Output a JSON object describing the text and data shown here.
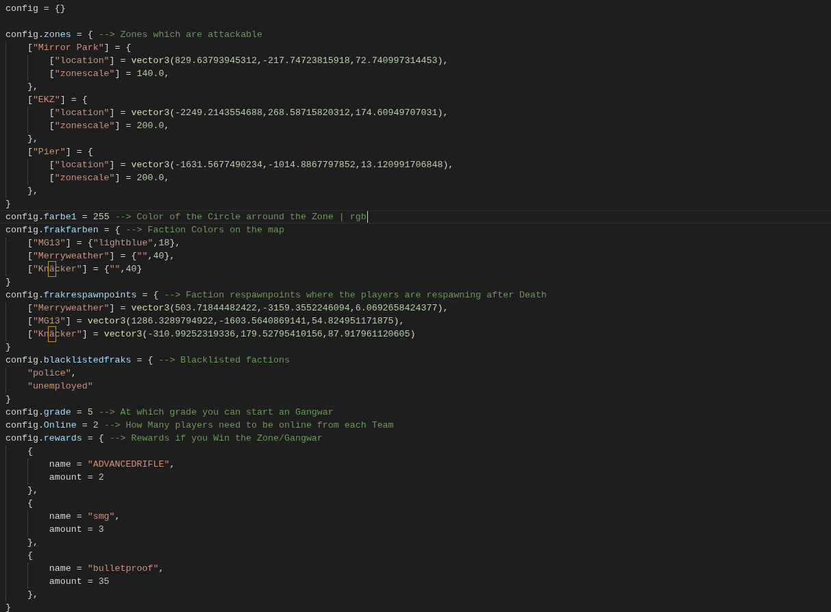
{
  "lines": [
    {
      "current": false,
      "tokens": [
        {
          "kind": "plain",
          "text": "config = {}"
        }
      ]
    },
    {
      "current": false
    },
    {
      "current": false,
      "tokens": [
        {
          "kind": "plain",
          "text": "config."
        },
        {
          "kind": "prop",
          "text": "zones"
        },
        {
          "kind": "plain",
          "text": " = { "
        },
        {
          "kind": "comment",
          "text": "--> Zones which are attackable"
        }
      ]
    },
    {
      "current": false,
      "tokens": [
        {
          "kind": "plain",
          "text": "    ["
        },
        {
          "kind": "str",
          "text": "\"Mirror Park\""
        },
        {
          "kind": "plain",
          "text": "] = {"
        }
      ]
    },
    {
      "current": false,
      "tokens": [
        {
          "kind": "plain",
          "text": "        ["
        },
        {
          "kind": "str",
          "text": "\"location\""
        },
        {
          "kind": "plain",
          "text": "] = "
        },
        {
          "kind": "func",
          "text": "vector3"
        },
        {
          "kind": "plain",
          "text": "("
        },
        {
          "kind": "num",
          "text": "829.63793945312"
        },
        {
          "kind": "plain",
          "text": ","
        },
        {
          "kind": "num",
          "text": "-217.74723815918"
        },
        {
          "kind": "plain",
          "text": ","
        },
        {
          "kind": "num",
          "text": "72.740997314453"
        },
        {
          "kind": "plain",
          "text": "),"
        }
      ]
    },
    {
      "current": false,
      "tokens": [
        {
          "kind": "plain",
          "text": "        ["
        },
        {
          "kind": "str",
          "text": "\"zonescale\""
        },
        {
          "kind": "plain",
          "text": "] = "
        },
        {
          "kind": "num",
          "text": "140.0"
        },
        {
          "kind": "plain",
          "text": ","
        }
      ]
    },
    {
      "current": false,
      "tokens": [
        {
          "kind": "plain",
          "text": "    },"
        }
      ]
    },
    {
      "current": false,
      "tokens": [
        {
          "kind": "plain",
          "text": "    ["
        },
        {
          "kind": "str",
          "text": "\"EKZ\""
        },
        {
          "kind": "plain",
          "text": "] = {"
        }
      ]
    },
    {
      "current": false,
      "tokens": [
        {
          "kind": "plain",
          "text": "        ["
        },
        {
          "kind": "str",
          "text": "\"location\""
        },
        {
          "kind": "plain",
          "text": "] = "
        },
        {
          "kind": "func",
          "text": "vector3"
        },
        {
          "kind": "plain",
          "text": "("
        },
        {
          "kind": "num",
          "text": "-2249.2143554688"
        },
        {
          "kind": "plain",
          "text": ","
        },
        {
          "kind": "num",
          "text": "268.58715820312"
        },
        {
          "kind": "plain",
          "text": ","
        },
        {
          "kind": "num",
          "text": "174.60949707031"
        },
        {
          "kind": "plain",
          "text": "),"
        }
      ]
    },
    {
      "current": false,
      "tokens": [
        {
          "kind": "plain",
          "text": "        ["
        },
        {
          "kind": "str",
          "text": "\"zonescale\""
        },
        {
          "kind": "plain",
          "text": "] = "
        },
        {
          "kind": "num",
          "text": "200.0"
        },
        {
          "kind": "plain",
          "text": ","
        }
      ]
    },
    {
      "current": false,
      "tokens": [
        {
          "kind": "plain",
          "text": "    },"
        }
      ]
    },
    {
      "current": false,
      "tokens": [
        {
          "kind": "plain",
          "text": "    ["
        },
        {
          "kind": "str",
          "text": "\"Pier\""
        },
        {
          "kind": "plain",
          "text": "] = {"
        }
      ]
    },
    {
      "current": false,
      "tokens": [
        {
          "kind": "plain",
          "text": "        ["
        },
        {
          "kind": "str",
          "text": "\"location\""
        },
        {
          "kind": "plain",
          "text": "] = "
        },
        {
          "kind": "func",
          "text": "vector3"
        },
        {
          "kind": "plain",
          "text": "("
        },
        {
          "kind": "num",
          "text": "-1631.5677490234"
        },
        {
          "kind": "plain",
          "text": ","
        },
        {
          "kind": "num",
          "text": "-1014.8867797852"
        },
        {
          "kind": "plain",
          "text": ","
        },
        {
          "kind": "num",
          "text": "13.120991706848"
        },
        {
          "kind": "plain",
          "text": "),"
        }
      ]
    },
    {
      "current": false,
      "tokens": [
        {
          "kind": "plain",
          "text": "        ["
        },
        {
          "kind": "str",
          "text": "\"zonescale\""
        },
        {
          "kind": "plain",
          "text": "] = "
        },
        {
          "kind": "num",
          "text": "200.0"
        },
        {
          "kind": "plain",
          "text": ","
        }
      ]
    },
    {
      "current": false,
      "tokens": [
        {
          "kind": "plain",
          "text": "    },"
        }
      ]
    },
    {
      "current": false,
      "tokens": [
        {
          "kind": "plain",
          "text": "}"
        }
      ]
    },
    {
      "current": true,
      "tokens": [
        {
          "kind": "plain",
          "text": "config."
        },
        {
          "kind": "prop",
          "text": "farbe1"
        },
        {
          "kind": "plain",
          "text": " = "
        },
        {
          "kind": "num",
          "text": "255"
        },
        {
          "kind": "comment",
          "text": "--> Color of the Circle arround the Zone | rgb"
        }
      ]
    },
    {
      "current": false,
      "tokens": [
        {
          "kind": "plain",
          "text": "config."
        },
        {
          "kind": "prop",
          "text": "frakfarben"
        },
        {
          "kind": "plain",
          "text": " = { "
        },
        {
          "kind": "comment",
          "text": "--> Faction Colors on the map"
        }
      ]
    },
    {
      "current": false,
      "tokens": [
        {
          "kind": "plain",
          "text": "    ["
        },
        {
          "kind": "str",
          "text": "\"MG13\""
        },
        {
          "kind": "plain",
          "text": "] = {"
        },
        {
          "kind": "str",
          "text": "\"lightblue\""
        },
        {
          "kind": "plain",
          "text": ","
        },
        {
          "kind": "num",
          "text": "18"
        },
        {
          "kind": "plain",
          "text": "},"
        }
      ]
    },
    {
      "current": false,
      "tokens": [
        {
          "kind": "plain",
          "text": "    ["
        },
        {
          "kind": "str",
          "text": "\"Merryweather\""
        },
        {
          "kind": "plain",
          "text": "] = {"
        },
        {
          "kind": "str",
          "text": "\"\""
        },
        {
          "kind": "plain",
          "text": ","
        },
        {
          "kind": "num",
          "text": "40"
        },
        {
          "kind": "plain",
          "text": "},"
        }
      ]
    },
    {
      "current": false,
      "tokens": [
        {
          "kind": "plain",
          "text": "    ["
        },
        {
          "kind": "str",
          "text": "\"Kn"
        },
        {
          "kind": "unicode",
          "text": "ä"
        },
        {
          "kind": "str",
          "text": "cker\""
        },
        {
          "kind": "plain",
          "text": "] = {"
        },
        {
          "kind": "str",
          "text": "\"\""
        },
        {
          "kind": "plain",
          "text": ","
        },
        {
          "kind": "num",
          "text": "40"
        },
        {
          "kind": "plain",
          "text": "}"
        }
      ]
    },
    {
      "current": false,
      "tokens": [
        {
          "kind": "plain",
          "text": "}"
        }
      ]
    },
    {
      "current": false,
      "tokens": [
        {
          "kind": "plain",
          "text": "config."
        },
        {
          "kind": "prop",
          "text": "frakrespawnpoints"
        },
        {
          "kind": "plain",
          "text": " = { "
        },
        {
          "kind": "comment",
          "text": "--> Faction respawnpoints where the players are respawning after Death"
        }
      ]
    },
    {
      "current": false,
      "tokens": [
        {
          "kind": "plain",
          "text": "    ["
        },
        {
          "kind": "str",
          "text": "\"Merryweather\""
        },
        {
          "kind": "plain",
          "text": "] = "
        },
        {
          "kind": "func",
          "text": "vector3"
        },
        {
          "kind": "plain",
          "text": "("
        },
        {
          "kind": "num",
          "text": "503.71844482422"
        },
        {
          "kind": "plain",
          "text": ","
        },
        {
          "kind": "num",
          "text": "-3159.3552246094"
        },
        {
          "kind": "plain",
          "text": ","
        },
        {
          "kind": "num",
          "text": "6.0692658424377"
        },
        {
          "kind": "plain",
          "text": "),"
        }
      ]
    },
    {
      "current": false,
      "tokens": [
        {
          "kind": "plain",
          "text": "    ["
        },
        {
          "kind": "str",
          "text": "\"MG13\""
        },
        {
          "kind": "plain",
          "text": "] = "
        },
        {
          "kind": "func",
          "text": "vector3"
        },
        {
          "kind": "plain",
          "text": "("
        },
        {
          "kind": "num",
          "text": "1286.3289794922"
        },
        {
          "kind": "plain",
          "text": ","
        },
        {
          "kind": "num",
          "text": "-1603.5640869141"
        },
        {
          "kind": "plain",
          "text": ","
        },
        {
          "kind": "num",
          "text": "54.824951171875"
        },
        {
          "kind": "plain",
          "text": "),"
        }
      ]
    },
    {
      "current": false,
      "tokens": [
        {
          "kind": "plain",
          "text": "    ["
        },
        {
          "kind": "str",
          "text": "\"Kn"
        },
        {
          "kind": "unicode",
          "text": "ä"
        },
        {
          "kind": "str",
          "text": "cker\""
        },
        {
          "kind": "plain",
          "text": "] = "
        },
        {
          "kind": "func",
          "text": "vector3"
        },
        {
          "kind": "plain",
          "text": "("
        },
        {
          "kind": "num",
          "text": "-310.99252319336"
        },
        {
          "kind": "plain",
          "text": ","
        },
        {
          "kind": "num",
          "text": "179.52795410156"
        },
        {
          "kind": "plain",
          "text": ","
        },
        {
          "kind": "num",
          "text": "87.917961120605"
        },
        {
          "kind": "plain",
          "text": ")"
        }
      ]
    },
    {
      "current": false,
      "tokens": [
        {
          "kind": "plain",
          "text": "}"
        }
      ]
    },
    {
      "current": false,
      "tokens": [
        {
          "kind": "plain",
          "text": "config."
        },
        {
          "kind": "prop",
          "text": "blacklistedfraks"
        },
        {
          "kind": "plain",
          "text": " = { "
        },
        {
          "kind": "comment",
          "text": "--> Blacklisted factions"
        }
      ]
    },
    {
      "current": false,
      "tokens": [
        {
          "kind": "str",
          "text": "    \"police\""
        },
        {
          "kind": "plain",
          "text": ","
        }
      ]
    },
    {
      "current": false,
      "tokens": [
        {
          "kind": "str",
          "text": "    \"unemployed\""
        }
      ]
    },
    {
      "current": false,
      "tokens": [
        {
          "kind": "plain",
          "text": "}"
        }
      ]
    },
    {
      "current": false,
      "tokens": [
        {
          "kind": "plain",
          "text": "config."
        },
        {
          "kind": "prop",
          "text": "grade"
        },
        {
          "kind": "plain",
          "text": " = "
        },
        {
          "kind": "num",
          "text": "5"
        },
        {
          "kind": "comment",
          "text": "--> At which grade you can start an Gangwar"
        }
      ]
    },
    {
      "current": false,
      "tokens": [
        {
          "kind": "plain",
          "text": "config."
        },
        {
          "kind": "prop",
          "text": "Online"
        },
        {
          "kind": "plain",
          "text": " = "
        },
        {
          "kind": "num",
          "text": "2"
        },
        {
          "kind": "comment",
          "text": "--> How Many players need to be online from each Team"
        }
      ]
    },
    {
      "current": false,
      "tokens": [
        {
          "kind": "plain",
          "text": "config."
        },
        {
          "kind": "prop",
          "text": "rewards"
        },
        {
          "kind": "plain",
          "text": " = { "
        },
        {
          "kind": "comment",
          "text": "--> Rewards if you Win the Zone/Gangwar"
        }
      ]
    },
    {
      "current": false,
      "tokens": [
        {
          "kind": "plain",
          "text": "    {"
        }
      ]
    },
    {
      "current": false,
      "tokens": [
        {
          "kind": "plain",
          "text": "        name = "
        },
        {
          "kind": "str",
          "text": "\"ADVANCEDRIFLE\""
        },
        {
          "kind": "plain",
          "text": ","
        }
      ]
    },
    {
      "current": false,
      "tokens": [
        {
          "kind": "plain",
          "text": "        amount = "
        },
        {
          "kind": "num",
          "text": "2"
        }
      ]
    },
    {
      "current": false,
      "tokens": [
        {
          "kind": "plain",
          "text": "    },"
        }
      ]
    },
    {
      "current": false,
      "tokens": [
        {
          "kind": "plain",
          "text": "    {"
        }
      ]
    },
    {
      "current": false,
      "tokens": [
        {
          "kind": "plain",
          "text": "        name = "
        },
        {
          "kind": "str",
          "text": "\"smg\""
        },
        {
          "kind": "plain",
          "text": ","
        }
      ]
    },
    {
      "current": false,
      "tokens": [
        {
          "kind": "plain",
          "text": "        amount = "
        },
        {
          "kind": "num",
          "text": "3"
        }
      ]
    },
    {
      "current": false,
      "tokens": [
        {
          "kind": "plain",
          "text": "    },"
        }
      ]
    },
    {
      "current": false,
      "tokens": [
        {
          "kind": "plain",
          "text": "    {"
        }
      ]
    },
    {
      "current": false,
      "tokens": [
        {
          "kind": "plain",
          "text": "        name = "
        },
        {
          "kind": "str",
          "text": "\"bulletproof\""
        },
        {
          "kind": "plain",
          "text": ","
        }
      ]
    },
    {
      "current": false,
      "tokens": [
        {
          "kind": "plain",
          "text": "        amount = "
        },
        {
          "kind": "num",
          "text": "35"
        }
      ]
    },
    {
      "current": false,
      "tokens": [
        {
          "kind": "plain",
          "text": "    },"
        }
      ]
    },
    {
      "current": false,
      "tokens": [
        {
          "kind": "plain",
          "text": "}"
        }
      ]
    }
  ]
}
